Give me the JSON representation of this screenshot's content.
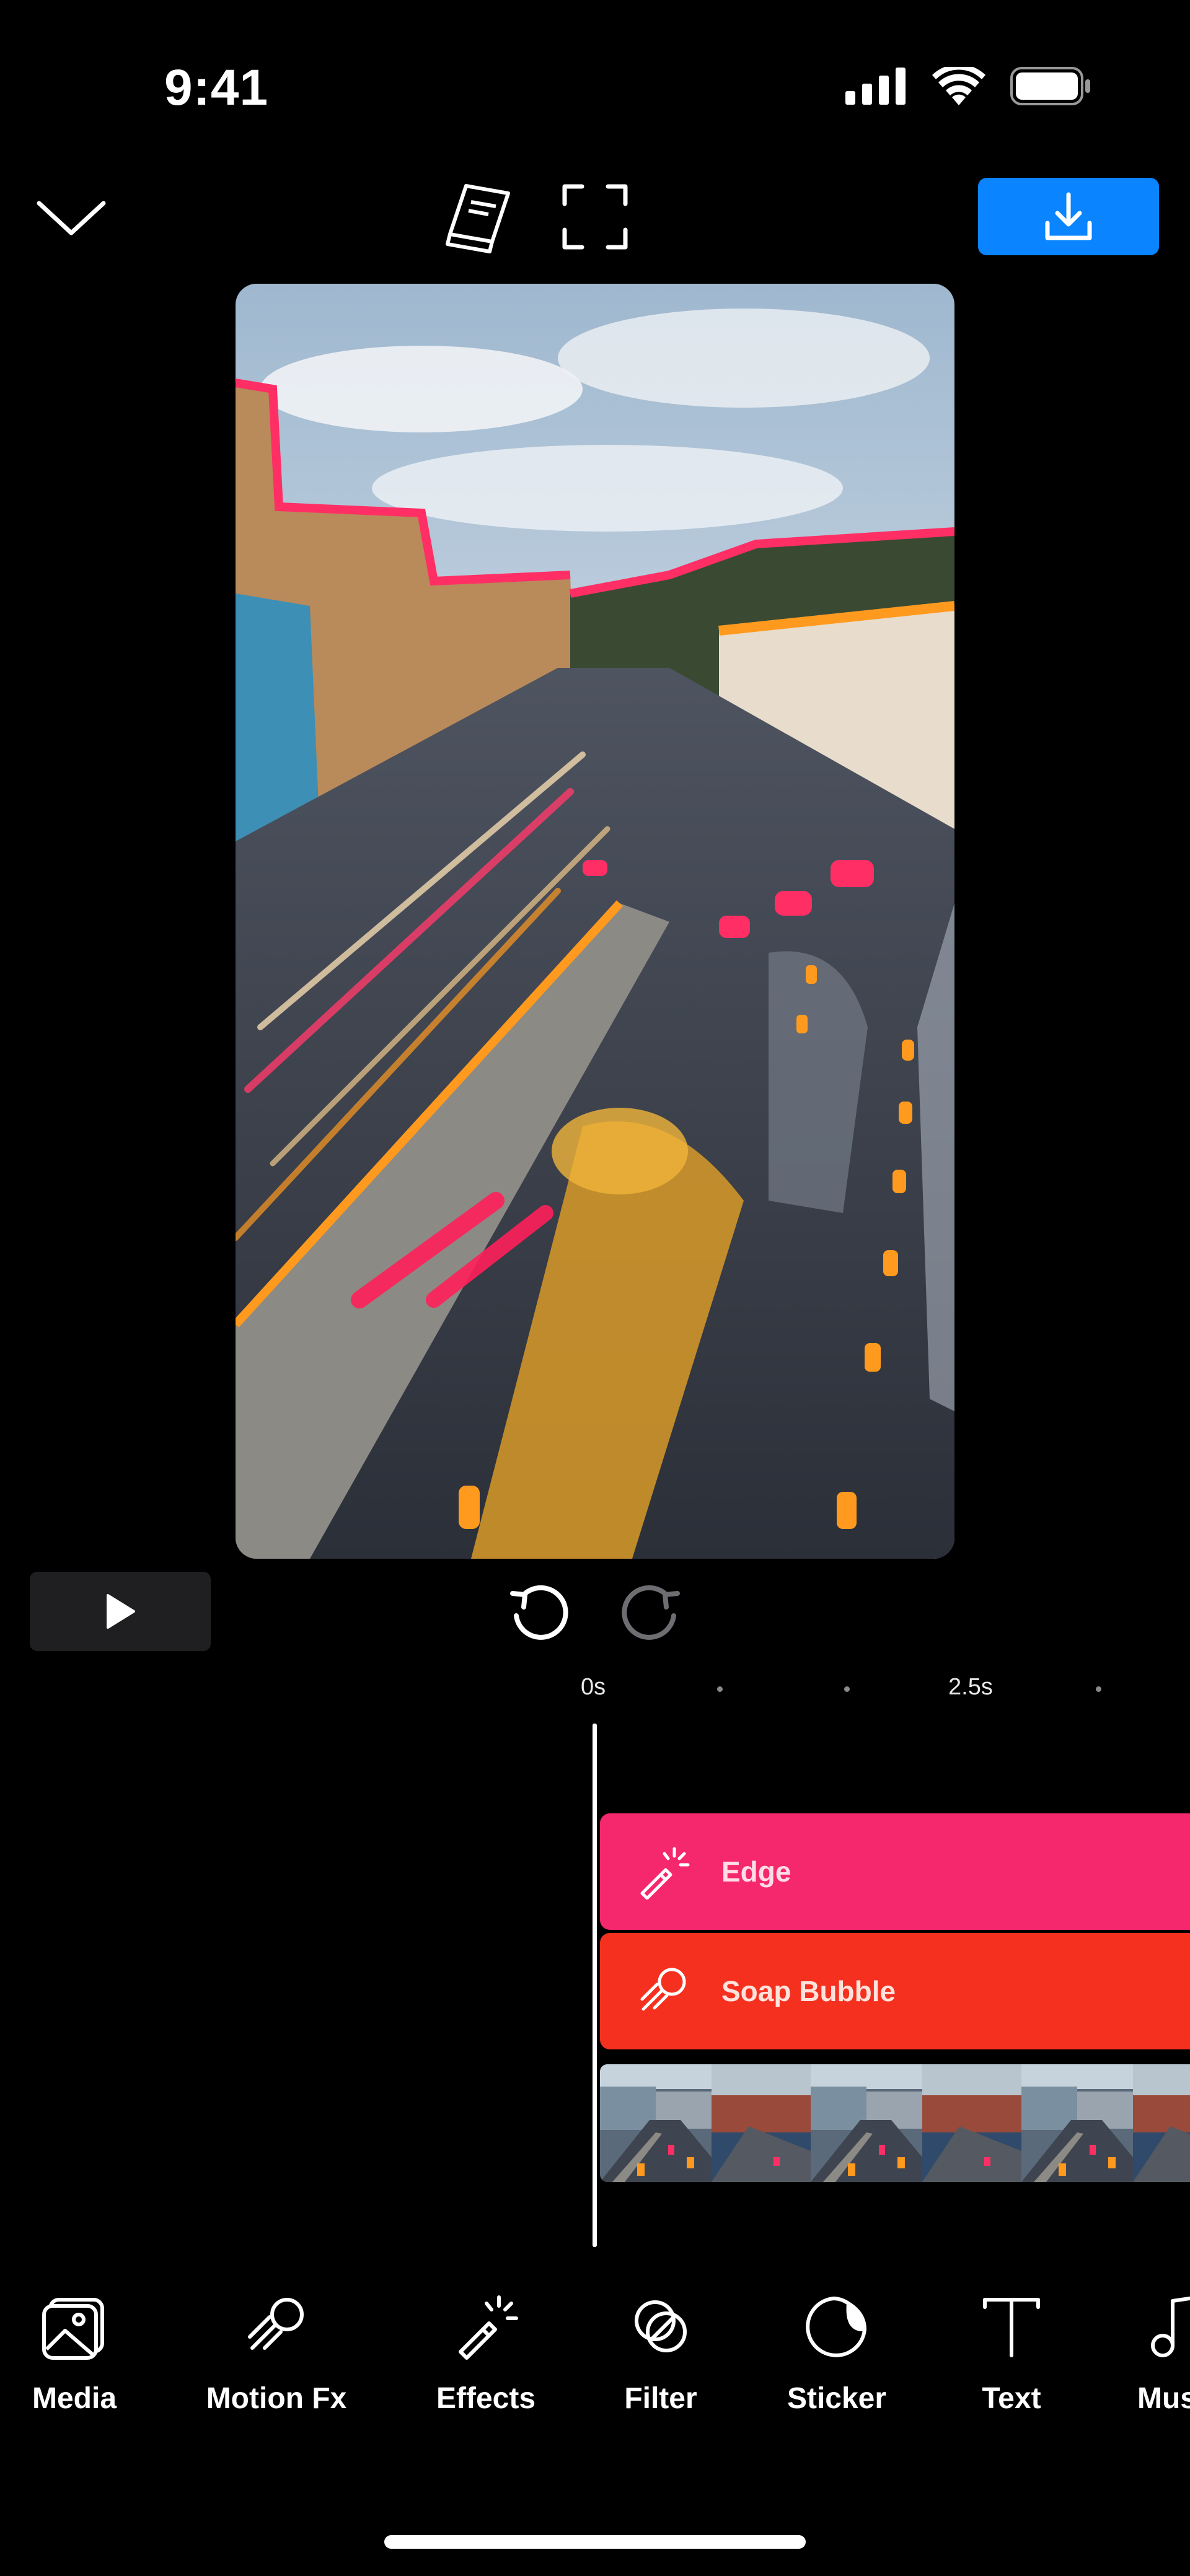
{
  "status_bar": {
    "time": "9:41"
  },
  "colors": {
    "background": "#000000",
    "export_button": "#0a84ff",
    "edge_track": "#f5286d",
    "soap_bubble_track": "#f5301f",
    "play_button_bg": "#1f1f21"
  },
  "top_bar": {
    "collapse_icon": "chevron-down-icon",
    "guide_icon": "book-icon",
    "fullscreen_icon": "fullscreen-icon",
    "export_icon": "download-icon"
  },
  "preview": {
    "subject": "long-exposure city traffic with edge effect"
  },
  "playback": {
    "play_icon": "play-icon",
    "undo_icon": "undo-icon",
    "redo_icon": "redo-icon"
  },
  "timeline": {
    "ruler_labels": [
      "0s",
      "2.5s"
    ],
    "tracks": [
      {
        "label": "Edge",
        "icon": "magic-wand-icon"
      },
      {
        "label": "Soap Bubble",
        "icon": "motion-fx-icon"
      }
    ]
  },
  "toolbar": {
    "items": [
      {
        "label": "Media",
        "icon": "media-icon"
      },
      {
        "label": "Motion Fx",
        "icon": "motion-fx-icon"
      },
      {
        "label": "Effects",
        "icon": "magic-wand-icon"
      },
      {
        "label": "Filter",
        "icon": "filter-icon"
      },
      {
        "label": "Sticker",
        "icon": "sticker-icon"
      },
      {
        "label": "Text",
        "icon": "text-icon"
      },
      {
        "label": "Music",
        "icon": "music-icon"
      }
    ]
  }
}
